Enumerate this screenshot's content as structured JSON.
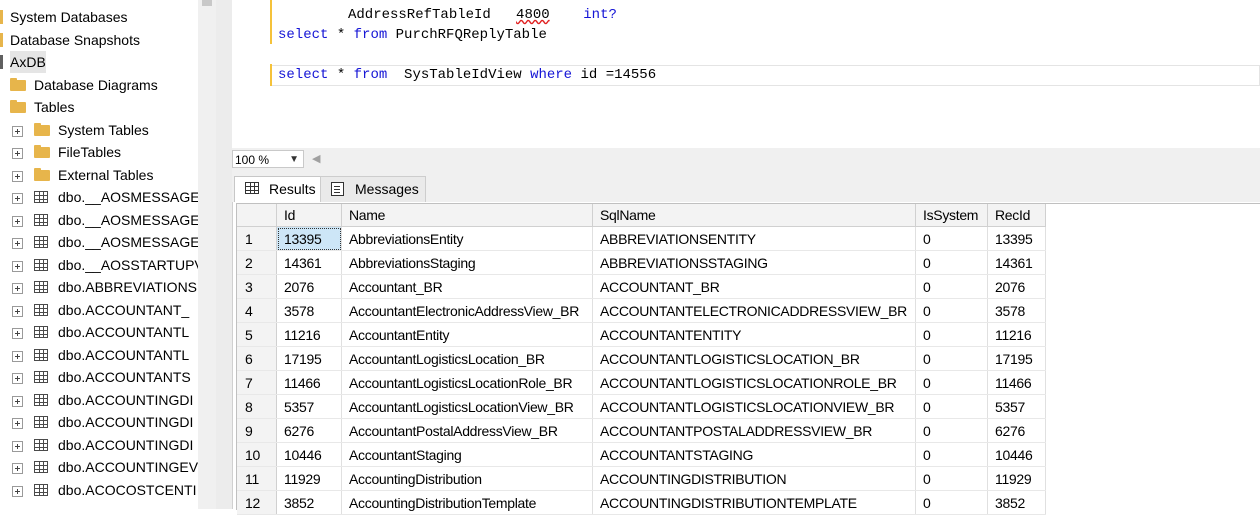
{
  "explorer": {
    "nodes": [
      {
        "label": "System Databases",
        "icon": "folder-icon",
        "expander": false
      },
      {
        "label": "Database Snapshots",
        "icon": "folder-icon",
        "expander": false
      },
      {
        "label": "AxDB",
        "icon": "database-icon",
        "expander": false,
        "selected": true
      },
      {
        "label": "Database Diagrams",
        "icon": "folder-icon",
        "expander": false
      },
      {
        "label": "Tables",
        "icon": "folder-icon",
        "expander": false
      },
      {
        "label": "System Tables",
        "icon": "folder-icon",
        "expander": true
      },
      {
        "label": "FileTables",
        "icon": "folder-icon",
        "expander": true
      },
      {
        "label": "External Tables",
        "icon": "folder-icon",
        "expander": true
      },
      {
        "label": "dbo.__AOSMESSAGEC",
        "icon": "table-icon",
        "expander": true
      },
      {
        "label": "dbo.__AOSMESSAGEI",
        "icon": "table-icon",
        "expander": true
      },
      {
        "label": "dbo.__AOSMESSAGET",
        "icon": "table-icon",
        "expander": true
      },
      {
        "label": "dbo.__AOSSTARTUPV",
        "icon": "table-icon",
        "expander": true
      },
      {
        "label": "dbo.ABBREVIATIONS",
        "icon": "table-icon",
        "expander": true
      },
      {
        "label": "dbo.ACCOUNTANT_",
        "icon": "table-icon",
        "expander": true
      },
      {
        "label": "dbo.ACCOUNTANTL",
        "icon": "table-icon",
        "expander": true
      },
      {
        "label": "dbo.ACCOUNTANTL",
        "icon": "table-icon",
        "expander": true
      },
      {
        "label": "dbo.ACCOUNTANTS",
        "icon": "table-icon",
        "expander": true
      },
      {
        "label": "dbo.ACCOUNTINGDI",
        "icon": "table-icon",
        "expander": true
      },
      {
        "label": "dbo.ACCOUNTINGDI",
        "icon": "table-icon",
        "expander": true
      },
      {
        "label": "dbo.ACCOUNTINGDI",
        "icon": "table-icon",
        "expander": true
      },
      {
        "label": "dbo.ACCOUNTINGEV",
        "icon": "table-icon",
        "expander": true
      },
      {
        "label": "dbo.ACOCOSTCENTI",
        "icon": "table-icon",
        "expander": true
      }
    ]
  },
  "editor": {
    "line1": {
      "text": "AddressRefTableId",
      "num": "4800",
      "type": "int?"
    },
    "line2": {
      "kw1": "select",
      "star": " * ",
      "kw2": "from",
      "rest": " PurchRFQReplyTable"
    },
    "line3": {
      "kw1": "select",
      "star": " * ",
      "kw2": "from",
      "mid": "  SysTableIdView ",
      "kw3": "where",
      "rest": " id =14556"
    }
  },
  "zoom": {
    "value": "100 %"
  },
  "tabs": {
    "results": "Results",
    "messages": "Messages"
  },
  "grid": {
    "columns": [
      "Id",
      "Name",
      "SqlName",
      "IsSystem",
      "RecId"
    ],
    "rows": [
      [
        "1",
        "13395",
        "AbbreviationsEntity",
        "ABBREVIATIONSENTITY",
        "0",
        "13395"
      ],
      [
        "2",
        "14361",
        "AbbreviationsStaging",
        "ABBREVIATIONSSTAGING",
        "0",
        "14361"
      ],
      [
        "3",
        "2076",
        "Accountant_BR",
        "ACCOUNTANT_BR",
        "0",
        "2076"
      ],
      [
        "4",
        "3578",
        "AccountantElectronicAddressView_BR",
        "ACCOUNTANTELECTRONICADDRESSVIEW_BR",
        "0",
        "3578"
      ],
      [
        "5",
        "11216",
        "AccountantEntity",
        "ACCOUNTANTENTITY",
        "0",
        "11216"
      ],
      [
        "6",
        "17195",
        "AccountantLogisticsLocation_BR",
        "ACCOUNTANTLOGISTICSLOCATION_BR",
        "0",
        "17195"
      ],
      [
        "7",
        "11466",
        "AccountantLogisticsLocationRole_BR",
        "ACCOUNTANTLOGISTICSLOCATIONROLE_BR",
        "0",
        "11466"
      ],
      [
        "8",
        "5357",
        "AccountantLogisticsLocationView_BR",
        "ACCOUNTANTLOGISTICSLOCATIONVIEW_BR",
        "0",
        "5357"
      ],
      [
        "9",
        "6276",
        "AccountantPostalAddressView_BR",
        "ACCOUNTANTPOSTALADDRESSVIEW_BR",
        "0",
        "6276"
      ],
      [
        "10",
        "10446",
        "AccountantStaging",
        "ACCOUNTANTSTAGING",
        "0",
        "10446"
      ],
      [
        "11",
        "11929",
        "AccountingDistribution",
        "ACCOUNTINGDISTRIBUTION",
        "0",
        "11929"
      ],
      [
        "12",
        "3852",
        "AccountingDistributionTemplate",
        "ACCOUNTINGDISTRIBUTIONTEMPLATE",
        "0",
        "3852"
      ]
    ]
  },
  "colors": {
    "keyword": "#1515d6",
    "selection": "#cde6f7",
    "folder": "#e7b54b"
  }
}
